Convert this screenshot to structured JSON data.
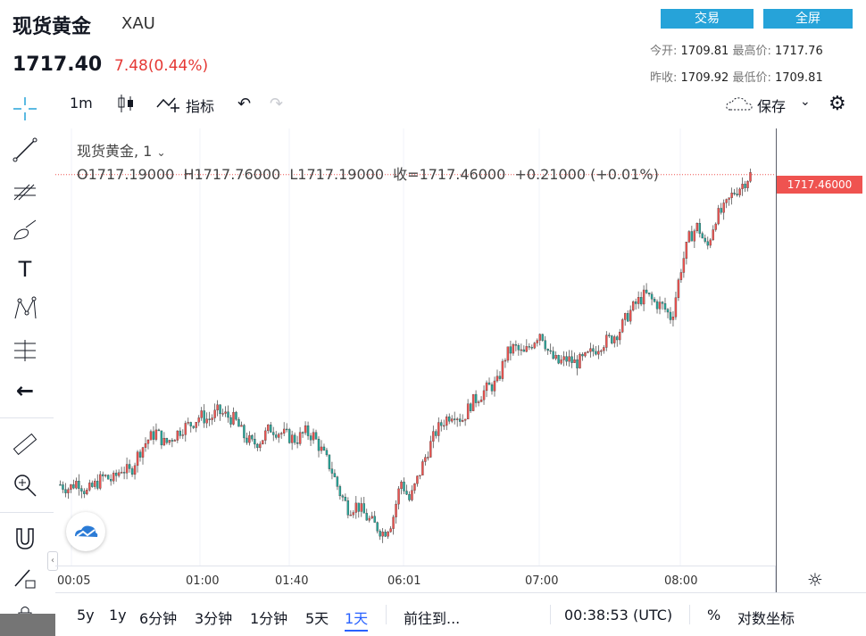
{
  "header": {
    "title": "现货黄金",
    "symbol": "XAU",
    "price": "1717.40",
    "change": "7.48(0.44%)",
    "trade_button": "交易",
    "fullscreen_button": "全屏",
    "stats": {
      "open_label": "今开:",
      "open": "1709.81",
      "high_label": "最高价:",
      "high": "1717.76",
      "prev_close_label": "昨收:",
      "prev_close": "1709.92",
      "low_label": "最低价:",
      "low": "1709.81"
    }
  },
  "toolbar": {
    "interval": "1m",
    "indicators": "指标",
    "save": "保存"
  },
  "legend": {
    "name": "现货黄金, 1",
    "ohlc": "O1717.19000  H1717.76000  L1717.19000  收=1717.46000  +0.21000 (+0.01%)"
  },
  "price_tag": "1717.46000",
  "bottom_bar": {
    "ranges": [
      "5y",
      "1y",
      "6分钟",
      "3分钟",
      "1分钟",
      "5天",
      "1天"
    ],
    "goto": "前往到...",
    "time": "00:38:53 (UTC)",
    "percent": "%",
    "log": "对数坐标"
  },
  "chart_data": {
    "type": "candlestick",
    "x_ticks": [
      "00:05",
      "01:00",
      "01:40",
      "06:01",
      "07:00",
      "08:00"
    ],
    "last_price": 1717.46,
    "ylim": [
      1707.8,
      1718.6
    ],
    "colors": {
      "up": "#ef5350",
      "down": "#26a69a"
    },
    "close_path": [
      1709.8,
      1709.7,
      1709.9,
      1709.6,
      1709.8,
      1710.0,
      1709.9,
      1710.2,
      1710.1,
      1710.6,
      1710.9,
      1711.1,
      1710.8,
      1711.0,
      1711.2,
      1711.3,
      1711.5,
      1711.4,
      1711.6,
      1711.5,
      1711.4,
      1711.0,
      1710.8,
      1710.9,
      1711.2,
      1711.1,
      1711.0,
      1710.9,
      1711.1,
      1711.0,
      1710.6,
      1710.2,
      1709.6,
      1709.2,
      1709.3,
      1709.0,
      1708.8,
      1708.6,
      1708.9,
      1709.9,
      1709.4,
      1710.0,
      1710.6,
      1711.1,
      1711.4,
      1711.6,
      1711.4,
      1711.8,
      1712.0,
      1712.2,
      1712.3,
      1713.0,
      1713.2,
      1713.0,
      1713.3,
      1713.6,
      1713.0,
      1712.8,
      1712.9,
      1712.8,
      1712.9,
      1713.1,
      1713.3,
      1713.4,
      1713.6,
      1714.0,
      1714.3,
      1714.5,
      1714.3,
      1714.2,
      1713.9,
      1715.1,
      1715.9,
      1716.2,
      1715.6,
      1716.4,
      1716.6,
      1717.0,
      1717.2,
      1717.46
    ]
  }
}
